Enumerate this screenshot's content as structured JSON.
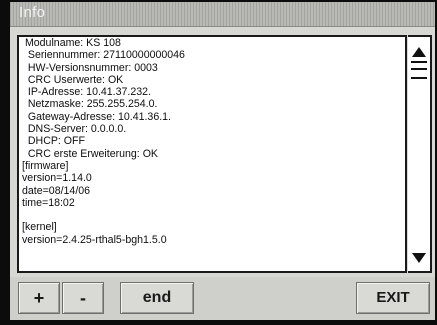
{
  "window": {
    "title": "Info"
  },
  "info_lines": [
    " Modulname: KS 108",
    "  Seriennummer: 27110000000046",
    "  HW-Versionsnummer: 0003",
    "  CRC Userwerte: OK",
    "  IP-Adresse: 10.41.37.232.",
    "  Netzmaske: 255.255.254.0.",
    "  Gateway-Adresse: 10.41.36.1.",
    "  DNS-Server: 0.0.0.0.",
    "  DHCP: OFF",
    "  CRC erste Erweiterung: OK",
    "[firmware]",
    "version=1.14.0",
    "date=08/14/06",
    "time=18:02",
    "",
    "[kernel]",
    "version=2.4.25-rthal5-bgh1.5.0"
  ],
  "scrollbar": {
    "up_icon": "triangle-up-icon",
    "thumb_icon": "scroll-thumb-icon",
    "down_icon": "triangle-down-icon",
    "position": 0
  },
  "buttons": {
    "plus": "+",
    "minus": "-",
    "end": "end",
    "exit": "EXIT"
  }
}
